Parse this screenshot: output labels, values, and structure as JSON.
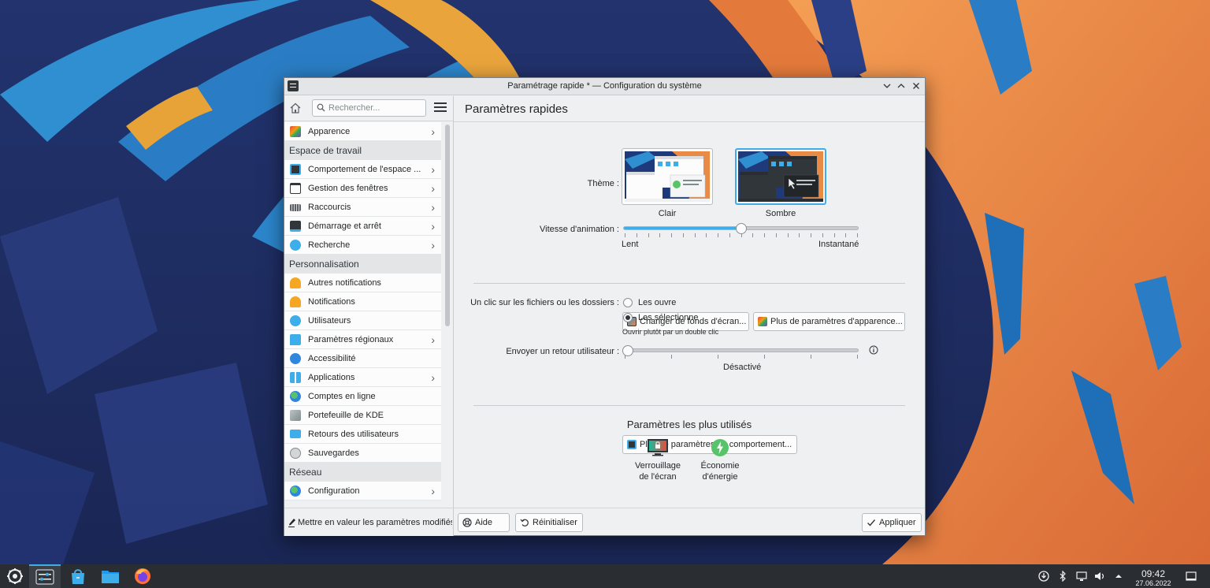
{
  "window": {
    "title": "Paramétrage rapide * — Configuration du système"
  },
  "sidebar": {
    "search_placeholder": "Rechercher...",
    "top_item": {
      "label": "Apparence",
      "icon": "appearance-icon"
    },
    "sections": [
      {
        "title": "Espace de travail",
        "items": [
          {
            "label": "Comportement de l'espace ...",
            "icon": "workspace-behavior-icon",
            "chevron": true
          },
          {
            "label": "Gestion des fenêtres",
            "icon": "window-management-icon",
            "chevron": true
          },
          {
            "label": "Raccourcis",
            "icon": "keyboard-icon",
            "chevron": true
          },
          {
            "label": "Démarrage et arrêt",
            "icon": "startup-icon",
            "chevron": true
          },
          {
            "label": "Recherche",
            "icon": "search-icon",
            "chevron": true
          }
        ]
      },
      {
        "title": "Personnalisation",
        "items": [
          {
            "label": "Autres notifications",
            "icon": "bell-icon",
            "chevron": false
          },
          {
            "label": "Notifications",
            "icon": "bell-icon",
            "chevron": false
          },
          {
            "label": "Utilisateurs",
            "icon": "users-icon",
            "chevron": false
          },
          {
            "label": "Paramètres régionaux",
            "icon": "chat-icon",
            "chevron": true
          },
          {
            "label": "Accessibilité",
            "icon": "accessibility-icon",
            "chevron": false
          },
          {
            "label": "Applications",
            "icon": "applications-icon",
            "chevron": true
          },
          {
            "label": "Comptes en ligne",
            "icon": "globe-icon",
            "chevron": false
          },
          {
            "label": "Portefeuille de KDE",
            "icon": "wallet-icon",
            "chevron": false
          },
          {
            "label": "Retours des utilisateurs",
            "icon": "feedback-icon",
            "chevron": false
          },
          {
            "label": "Sauvegardes",
            "icon": "backup-icon",
            "chevron": false
          }
        ]
      },
      {
        "title": "Réseau",
        "items": [
          {
            "label": "Configuration",
            "icon": "globe-icon",
            "chevron": true
          }
        ]
      }
    ],
    "footer_label": "Mettre en valeur les paramètres modifiés"
  },
  "main": {
    "title": "Paramètres rapides",
    "theme": {
      "label": "Thème :",
      "options": [
        {
          "label": "Clair",
          "selected": false
        },
        {
          "label": "Sombre",
          "selected": true
        }
      ]
    },
    "animation": {
      "label": "Vitesse d'animation :",
      "min_label": "Lent",
      "max_label": "Instantané",
      "value_fraction": 0.5
    },
    "buttons_appearance": {
      "wallpaper": "Changer de fonds d'écran...",
      "more_appearance": "Plus de paramètres d'apparence..."
    },
    "click_behavior": {
      "label": "Un clic sur les fichiers ou les dossiers :",
      "options": [
        {
          "label": "Les ouvre",
          "selected": false
        },
        {
          "label": "Les sélectionne",
          "selected": true
        }
      ],
      "hint": "Ouvrir plutôt par un double clic"
    },
    "feedback": {
      "label": "Envoyer un retour utilisateur :",
      "value_label": "Désactivé",
      "value_fraction": 0
    },
    "buttons_behavior": {
      "more_behavior": "Plus de paramètres de comportement..."
    },
    "most_used": {
      "title": "Paramètres les plus utilisés",
      "items": [
        {
          "line1": "Verrouillage",
          "line2": "de l'écran",
          "icon": "screen-lock-icon"
        },
        {
          "line1": "Économie",
          "line2": "d'énergie",
          "icon": "power-icon"
        }
      ]
    }
  },
  "bottom_bar": {
    "help": "Aide",
    "reset": "Réinitialiser",
    "apply": "Appliquer"
  },
  "taskbar": {
    "time": "09:42",
    "date": "27.06.2022"
  },
  "colors": {
    "accent": "#3daee9",
    "window_bg": "#eff0f1",
    "taskbar_bg": "#2a2e32"
  }
}
